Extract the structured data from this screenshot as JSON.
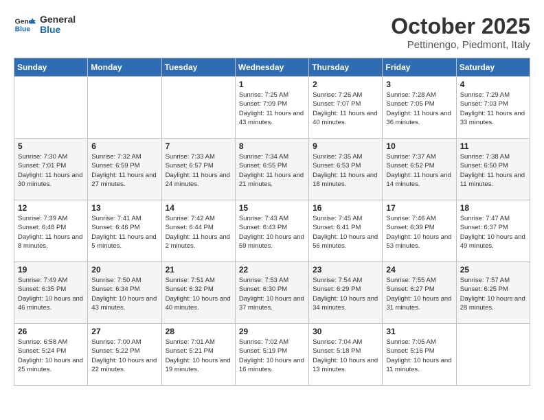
{
  "header": {
    "logo_line1": "General",
    "logo_line2": "Blue",
    "month": "October 2025",
    "location": "Pettinengo, Piedmont, Italy"
  },
  "days_of_week": [
    "Sunday",
    "Monday",
    "Tuesday",
    "Wednesday",
    "Thursday",
    "Friday",
    "Saturday"
  ],
  "weeks": [
    [
      {
        "num": "",
        "info": ""
      },
      {
        "num": "",
        "info": ""
      },
      {
        "num": "",
        "info": ""
      },
      {
        "num": "1",
        "info": "Sunrise: 7:25 AM\nSunset: 7:09 PM\nDaylight: 11 hours and 43 minutes."
      },
      {
        "num": "2",
        "info": "Sunrise: 7:26 AM\nSunset: 7:07 PM\nDaylight: 11 hours and 40 minutes."
      },
      {
        "num": "3",
        "info": "Sunrise: 7:28 AM\nSunset: 7:05 PM\nDaylight: 11 hours and 36 minutes."
      },
      {
        "num": "4",
        "info": "Sunrise: 7:29 AM\nSunset: 7:03 PM\nDaylight: 11 hours and 33 minutes."
      }
    ],
    [
      {
        "num": "5",
        "info": "Sunrise: 7:30 AM\nSunset: 7:01 PM\nDaylight: 11 hours and 30 minutes."
      },
      {
        "num": "6",
        "info": "Sunrise: 7:32 AM\nSunset: 6:59 PM\nDaylight: 11 hours and 27 minutes."
      },
      {
        "num": "7",
        "info": "Sunrise: 7:33 AM\nSunset: 6:57 PM\nDaylight: 11 hours and 24 minutes."
      },
      {
        "num": "8",
        "info": "Sunrise: 7:34 AM\nSunset: 6:55 PM\nDaylight: 11 hours and 21 minutes."
      },
      {
        "num": "9",
        "info": "Sunrise: 7:35 AM\nSunset: 6:53 PM\nDaylight: 11 hours and 18 minutes."
      },
      {
        "num": "10",
        "info": "Sunrise: 7:37 AM\nSunset: 6:52 PM\nDaylight: 11 hours and 14 minutes."
      },
      {
        "num": "11",
        "info": "Sunrise: 7:38 AM\nSunset: 6:50 PM\nDaylight: 11 hours and 11 minutes."
      }
    ],
    [
      {
        "num": "12",
        "info": "Sunrise: 7:39 AM\nSunset: 6:48 PM\nDaylight: 11 hours and 8 minutes."
      },
      {
        "num": "13",
        "info": "Sunrise: 7:41 AM\nSunset: 6:46 PM\nDaylight: 11 hours and 5 minutes."
      },
      {
        "num": "14",
        "info": "Sunrise: 7:42 AM\nSunset: 6:44 PM\nDaylight: 11 hours and 2 minutes."
      },
      {
        "num": "15",
        "info": "Sunrise: 7:43 AM\nSunset: 6:43 PM\nDaylight: 10 hours and 59 minutes."
      },
      {
        "num": "16",
        "info": "Sunrise: 7:45 AM\nSunset: 6:41 PM\nDaylight: 10 hours and 56 minutes."
      },
      {
        "num": "17",
        "info": "Sunrise: 7:46 AM\nSunset: 6:39 PM\nDaylight: 10 hours and 53 minutes."
      },
      {
        "num": "18",
        "info": "Sunrise: 7:47 AM\nSunset: 6:37 PM\nDaylight: 10 hours and 49 minutes."
      }
    ],
    [
      {
        "num": "19",
        "info": "Sunrise: 7:49 AM\nSunset: 6:35 PM\nDaylight: 10 hours and 46 minutes."
      },
      {
        "num": "20",
        "info": "Sunrise: 7:50 AM\nSunset: 6:34 PM\nDaylight: 10 hours and 43 minutes."
      },
      {
        "num": "21",
        "info": "Sunrise: 7:51 AM\nSunset: 6:32 PM\nDaylight: 10 hours and 40 minutes."
      },
      {
        "num": "22",
        "info": "Sunrise: 7:53 AM\nSunset: 6:30 PM\nDaylight: 10 hours and 37 minutes."
      },
      {
        "num": "23",
        "info": "Sunrise: 7:54 AM\nSunset: 6:29 PM\nDaylight: 10 hours and 34 minutes."
      },
      {
        "num": "24",
        "info": "Sunrise: 7:55 AM\nSunset: 6:27 PM\nDaylight: 10 hours and 31 minutes."
      },
      {
        "num": "25",
        "info": "Sunrise: 7:57 AM\nSunset: 6:25 PM\nDaylight: 10 hours and 28 minutes."
      }
    ],
    [
      {
        "num": "26",
        "info": "Sunrise: 6:58 AM\nSunset: 5:24 PM\nDaylight: 10 hours and 25 minutes."
      },
      {
        "num": "27",
        "info": "Sunrise: 7:00 AM\nSunset: 5:22 PM\nDaylight: 10 hours and 22 minutes."
      },
      {
        "num": "28",
        "info": "Sunrise: 7:01 AM\nSunset: 5:21 PM\nDaylight: 10 hours and 19 minutes."
      },
      {
        "num": "29",
        "info": "Sunrise: 7:02 AM\nSunset: 5:19 PM\nDaylight: 10 hours and 16 minutes."
      },
      {
        "num": "30",
        "info": "Sunrise: 7:04 AM\nSunset: 5:18 PM\nDaylight: 10 hours and 13 minutes."
      },
      {
        "num": "31",
        "info": "Sunrise: 7:05 AM\nSunset: 5:16 PM\nDaylight: 10 hours and 11 minutes."
      },
      {
        "num": "",
        "info": ""
      }
    ]
  ]
}
